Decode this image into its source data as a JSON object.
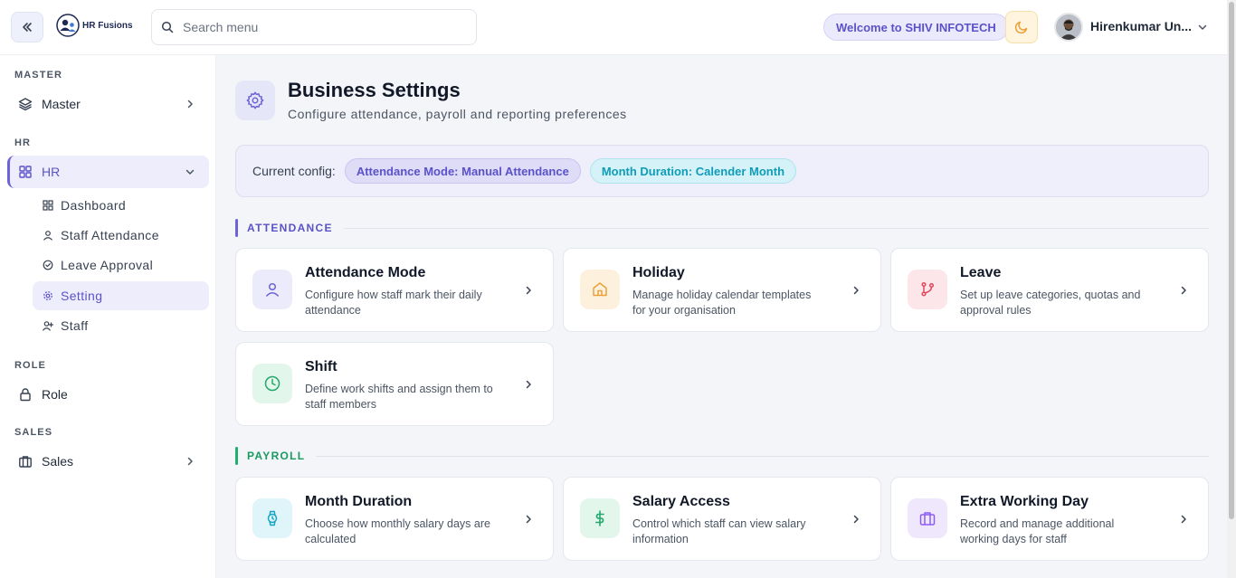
{
  "brand": {
    "name": "HR Fusions"
  },
  "search": {
    "placeholder": "Search menu"
  },
  "header": {
    "welcome": "Welcome to SHIV INFOTECH",
    "user_name": "Hirenkumar Un..."
  },
  "sidebar": {
    "sections": {
      "master": {
        "title": "MASTER",
        "item": "Master"
      },
      "hr": {
        "title": "HR",
        "item": "HR",
        "subitems": [
          "Dashboard",
          "Staff Attendance",
          "Leave Approval",
          "Setting",
          "Staff"
        ]
      },
      "role": {
        "title": "ROLE",
        "item": "Role"
      },
      "sales": {
        "title": "SALES",
        "item": "Sales"
      }
    },
    "active_item": "Setting"
  },
  "page": {
    "title": "Business Settings",
    "subtitle": "Configure attendance, payroll and reporting preferences",
    "config_label": "Current config:",
    "config_chips": [
      "Attendance Mode: Manual Attendance",
      "Month Duration: Calender Month"
    ]
  },
  "sections": [
    {
      "label": "ATTENDANCE",
      "accent": "#6c63d8",
      "cards": [
        {
          "title": "Attendance Mode",
          "desc": "Configure how staff mark their daily attendance",
          "icon": "user-icon",
          "color": "#6c63d8",
          "bg": "#ecebfb"
        },
        {
          "title": "Holiday",
          "desc": "Manage holiday calendar templates for your organisation",
          "icon": "home-icon",
          "color": "#e9a23b",
          "bg": "#fdf1de"
        },
        {
          "title": "Leave",
          "desc": "Set up leave categories, quotas and approval rules",
          "icon": "branch-icon",
          "color": "#e0465e",
          "bg": "#fde6ea"
        },
        {
          "title": "Shift",
          "desc": "Define work shifts and assign them to staff members",
          "icon": "clock-icon",
          "color": "#22a86b",
          "bg": "#e2f6ec"
        }
      ]
    },
    {
      "label": "PAYROLL",
      "accent": "#1fae6e",
      "cards": [
        {
          "title": "Month Duration",
          "desc": "Choose how monthly salary days are calculated",
          "icon": "watch-icon",
          "color": "#16a6c2",
          "bg": "#e0f5f9"
        },
        {
          "title": "Salary Access",
          "desc": "Control which staff can view salary information",
          "icon": "dollar-icon",
          "color": "#22a86b",
          "bg": "#e2f6ec"
        },
        {
          "title": "Extra Working Day",
          "desc": "Record and manage additional working days for staff",
          "icon": "briefcase-icon",
          "color": "#8b5cf6",
          "bg": "#efe8fd"
        }
      ]
    }
  ]
}
